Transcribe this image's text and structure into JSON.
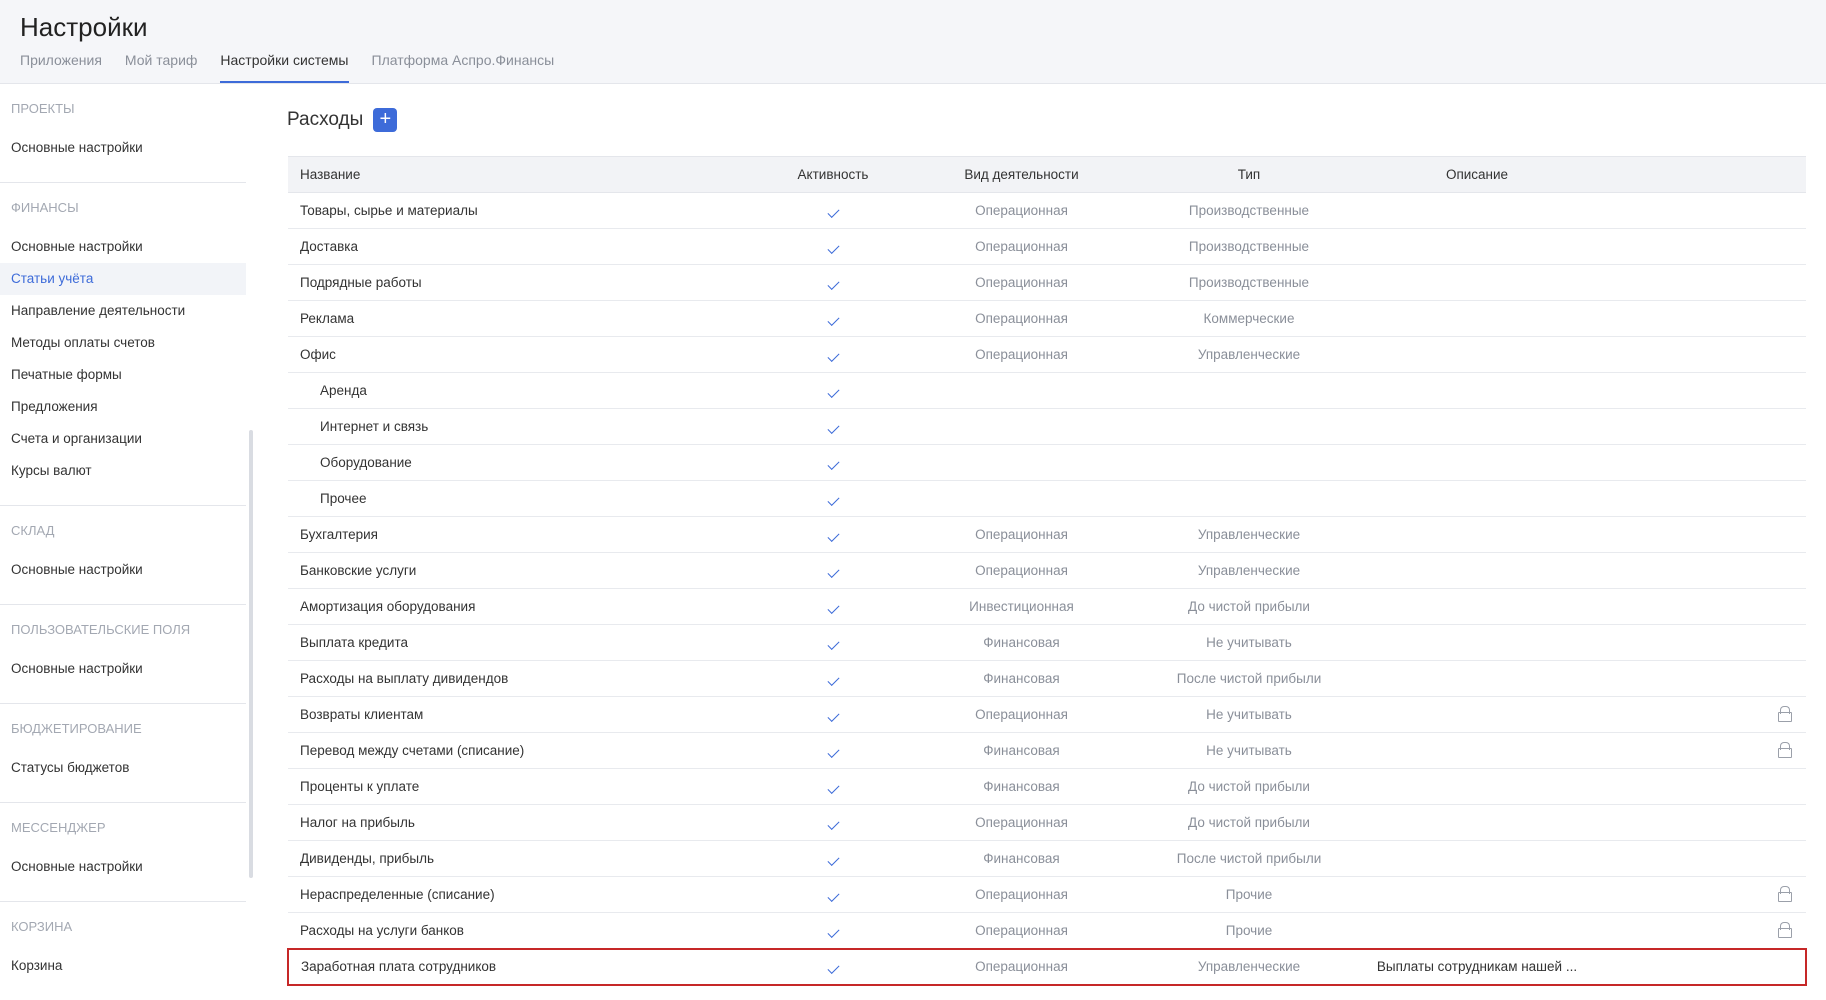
{
  "header": {
    "title": "Настройки",
    "tabs": [
      "Приложения",
      "Мой тариф",
      "Настройки системы",
      "Платформа Аспро.Финансы"
    ],
    "active_tab": 2
  },
  "sidebar": {
    "sections": [
      {
        "heading": "Проекты",
        "items": [
          "Основные настройки"
        ]
      },
      {
        "heading": "Финансы",
        "items": [
          "Основные настройки",
          "Статьи учёта",
          "Направление деятельности",
          "Методы оплаты счетов",
          "Печатные формы",
          "Предложения",
          "Счета и организации",
          "Курсы валют"
        ]
      },
      {
        "heading": "Склад",
        "items": [
          "Основные настройки"
        ]
      },
      {
        "heading": "Пользовательские поля",
        "items": [
          "Основные настройки"
        ]
      },
      {
        "heading": "Бюджетирование",
        "items": [
          "Статусы бюджетов"
        ]
      },
      {
        "heading": "Мессенджер",
        "items": [
          "Основные настройки"
        ]
      },
      {
        "heading": "Корзина",
        "items": [
          "Корзина"
        ]
      }
    ],
    "active_item": "Статьи учёта"
  },
  "main": {
    "section_title": "Расходы",
    "add_label": "+",
    "columns": {
      "name": "Название",
      "active": "Активность",
      "activity": "Вид деятельности",
      "type": "Тип",
      "description": "Описание"
    },
    "rows": [
      {
        "name": "Товары, сырье и материалы",
        "active": true,
        "activity": "Операционная",
        "type": "Производственные",
        "description": "",
        "locked": false,
        "child": false
      },
      {
        "name": "Доставка",
        "active": true,
        "activity": "Операционная",
        "type": "Производственные",
        "description": "",
        "locked": false,
        "child": false
      },
      {
        "name": "Подрядные работы",
        "active": true,
        "activity": "Операционная",
        "type": "Производственные",
        "description": "",
        "locked": false,
        "child": false
      },
      {
        "name": "Реклама",
        "active": true,
        "activity": "Операционная",
        "type": "Коммерческие",
        "description": "",
        "locked": false,
        "child": false
      },
      {
        "name": "Офис",
        "active": true,
        "activity": "Операционная",
        "type": "Управленческие",
        "description": "",
        "locked": false,
        "child": false
      },
      {
        "name": "Аренда",
        "active": true,
        "activity": "",
        "type": "",
        "description": "",
        "locked": false,
        "child": true
      },
      {
        "name": "Интернет и связь",
        "active": true,
        "activity": "",
        "type": "",
        "description": "",
        "locked": false,
        "child": true
      },
      {
        "name": "Оборудование",
        "active": true,
        "activity": "",
        "type": "",
        "description": "",
        "locked": false,
        "child": true
      },
      {
        "name": "Прочее",
        "active": true,
        "activity": "",
        "type": "",
        "description": "",
        "locked": false,
        "child": true
      },
      {
        "name": "Бухгалтерия",
        "active": true,
        "activity": "Операционная",
        "type": "Управленческие",
        "description": "",
        "locked": false,
        "child": false
      },
      {
        "name": "Банковские услуги",
        "active": true,
        "activity": "Операционная",
        "type": "Управленческие",
        "description": "",
        "locked": false,
        "child": false
      },
      {
        "name": "Амортизация оборудования",
        "active": true,
        "activity": "Инвестиционная",
        "type": "До чистой прибыли",
        "description": "",
        "locked": false,
        "child": false
      },
      {
        "name": "Выплата кредита",
        "active": true,
        "activity": "Финансовая",
        "type": "Не учитывать",
        "description": "",
        "locked": false,
        "child": false
      },
      {
        "name": "Расходы на выплату дивидендов",
        "active": true,
        "activity": "Финансовая",
        "type": "После чистой прибыли",
        "description": "",
        "locked": false,
        "child": false
      },
      {
        "name": "Возвраты клиентам",
        "active": true,
        "activity": "Операционная",
        "type": "Не учитывать",
        "description": "",
        "locked": true,
        "child": false
      },
      {
        "name": "Перевод между счетами (списание)",
        "active": true,
        "activity": "Финансовая",
        "type": "Не учитывать",
        "description": "",
        "locked": true,
        "child": false
      },
      {
        "name": "Проценты к уплате",
        "active": true,
        "activity": "Финансовая",
        "type": "До чистой прибыли",
        "description": "",
        "locked": false,
        "child": false
      },
      {
        "name": "Налог на прибыль",
        "active": true,
        "activity": "Операционная",
        "type": "До чистой прибыли",
        "description": "",
        "locked": false,
        "child": false
      },
      {
        "name": "Дивиденды, прибыль",
        "active": true,
        "activity": "Финансовая",
        "type": "После чистой прибыли",
        "description": "",
        "locked": false,
        "child": false
      },
      {
        "name": "Нераспределенные (списание)",
        "active": true,
        "activity": "Операционная",
        "type": "Прочие",
        "description": "",
        "locked": true,
        "child": false
      },
      {
        "name": "Расходы на услуги банков",
        "active": true,
        "activity": "Операционная",
        "type": "Прочие",
        "description": "",
        "locked": true,
        "child": false
      },
      {
        "name": "Заработная плата сотрудников",
        "active": true,
        "activity": "Операционная",
        "type": "Управленческие",
        "description": "Выплаты сотрудникам нашей ...",
        "locked": false,
        "child": false,
        "highlighted": true
      }
    ]
  }
}
